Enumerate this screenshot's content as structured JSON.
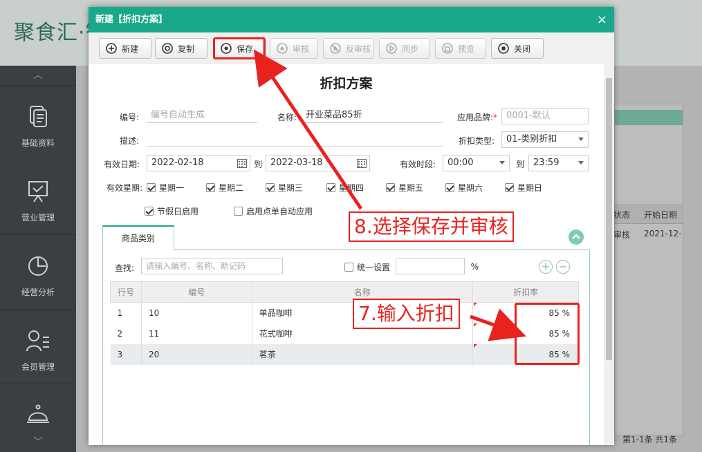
{
  "app": {
    "logo": "聚食汇·智"
  },
  "sidebar": {
    "items": [
      {
        "label": "基础资料",
        "icon": "document-icon"
      },
      {
        "label": "营业管理",
        "icon": "presentation-board-icon"
      },
      {
        "label": "经营分析",
        "icon": "pie-chart-icon"
      },
      {
        "label": "会员管理",
        "icon": "member-list-icon"
      },
      {
        "label": "",
        "icon": "service-bell-icon"
      }
    ]
  },
  "background": {
    "col_status": "状态",
    "col_start": "开始日期",
    "row_status": "审核",
    "row_start": "2021-12-",
    "pager": "第1-1条 共1条"
  },
  "modal": {
    "title": "新建【折扣方案】",
    "close": "×",
    "toolbar": {
      "new": "新建",
      "copy": "复制",
      "save": "保存",
      "audit": "审核",
      "unaudit": "反审核",
      "sync": "同步",
      "preview": "预览",
      "close": "关闭"
    },
    "form_title": "折扣方案",
    "fields": {
      "code_label": "编号:",
      "code_placeholder": "编号自动生成",
      "name_label": "名称:",
      "name_value": "开业菜品85折",
      "brand_label": "应用品牌:",
      "brand_required": "*",
      "brand_value": "0001-默认",
      "desc_label": "描述:",
      "desc_value": "",
      "discount_type_label": "折扣类型:",
      "discount_type_value": "01-类别折扣",
      "valid_date_label": "有效日期:",
      "date_from": "2022-02-18",
      "to_label": "到",
      "date_to": "2022-03-18",
      "valid_time_label": "有效时段:",
      "time_from": "00:00",
      "time_to": "23:59",
      "weekday_label": "有效星期:",
      "weekdays": [
        "星期一",
        "星期二",
        "星期三",
        "星期四",
        "星期五",
        "星期六",
        "星期日"
      ],
      "holiday_label": "节假日启用",
      "auto_apply_label": "启用点单自动应用"
    },
    "tab": {
      "label": "商品类别"
    },
    "search": {
      "label": "查找:",
      "placeholder": "请输入编号、名称、助记码"
    },
    "unified": {
      "label": "统一设置",
      "value": "",
      "unit": "%"
    },
    "grid": {
      "headers": [
        "行号",
        "编号",
        "名称",
        "折扣率"
      ],
      "rows": [
        {
          "row": "1",
          "code": "10",
          "name": "单品咖啡",
          "rate": "85 %"
        },
        {
          "row": "2",
          "code": "11",
          "name": "花式咖啡",
          "rate": "85 %"
        },
        {
          "row": "3",
          "code": "20",
          "name": "茗茶",
          "rate": "85 %"
        }
      ]
    }
  },
  "annotations": {
    "step8": "8.选择保存并审核",
    "step7": "7.输入折扣",
    "color": "#e8231f"
  },
  "colors": {
    "accent": "#1aa88a",
    "sidebar": "#3b3f41"
  }
}
